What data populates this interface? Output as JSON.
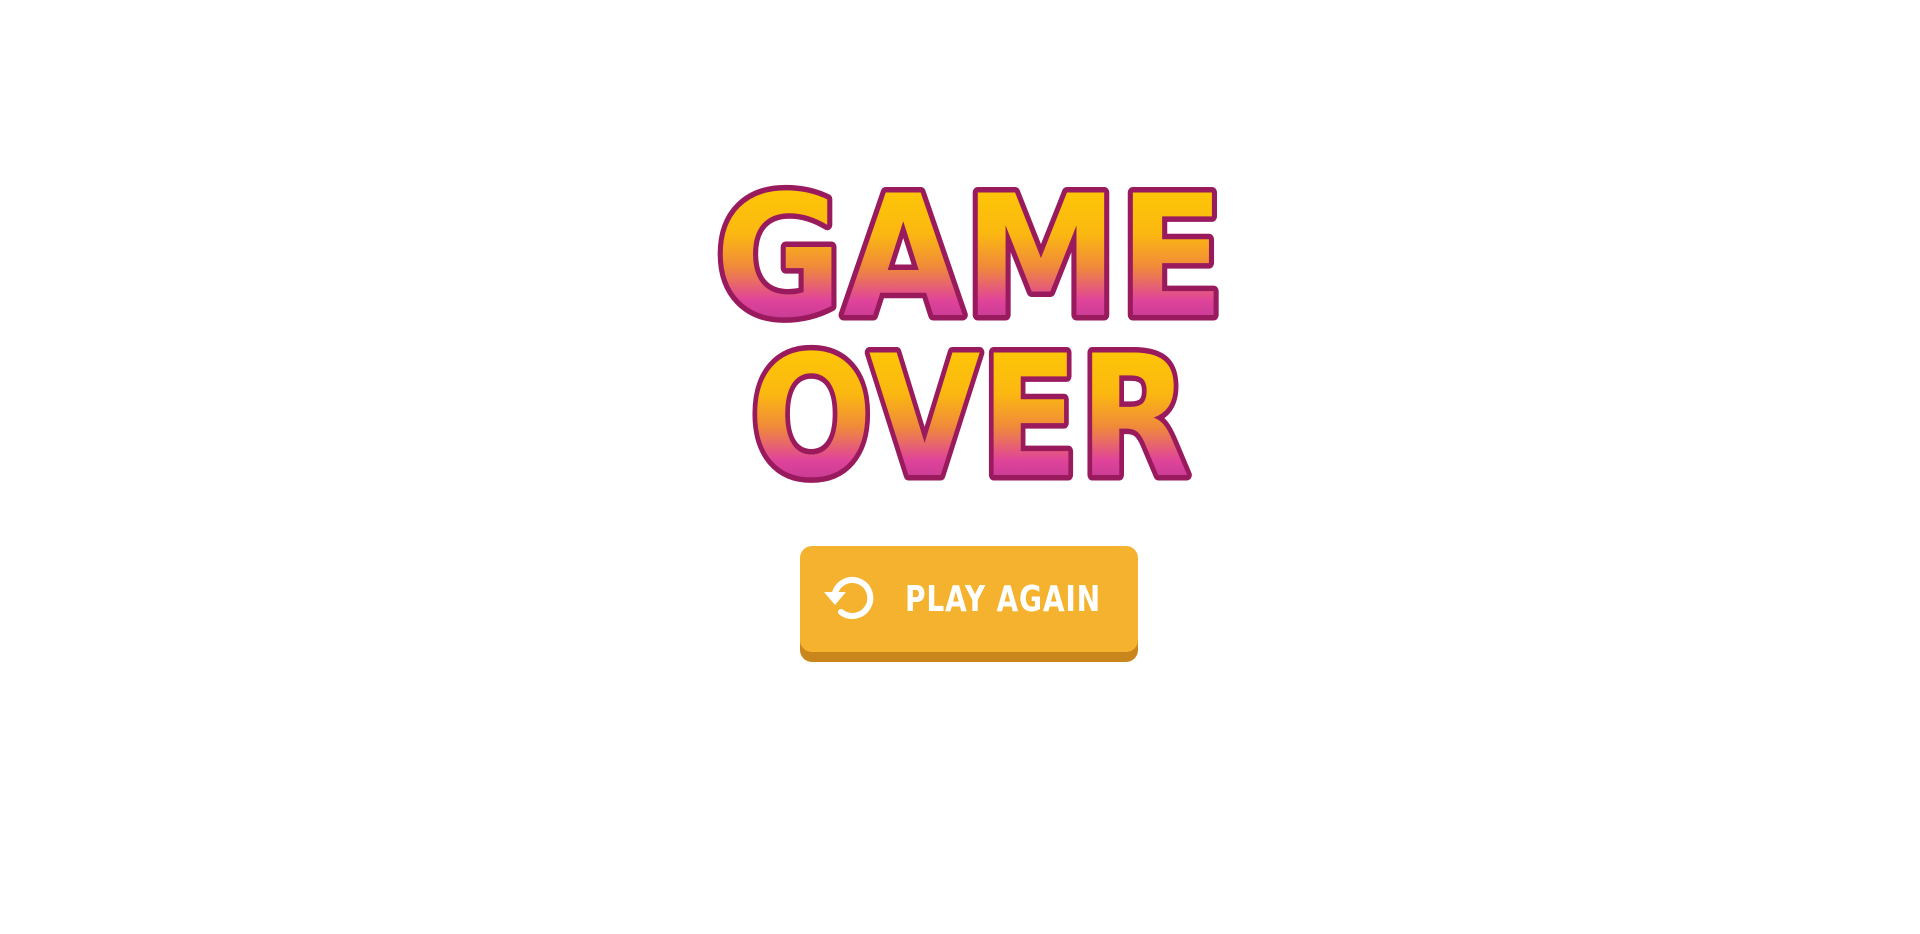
{
  "title": {
    "line1": "GAME",
    "line2": "OVER",
    "colors": {
      "gradient_top": "#ffd000",
      "gradient_mid": "#f08a3a",
      "gradient_low": "#e0449a",
      "gradient_bottom": "#9b2a8c",
      "outline": "#9a1a5e"
    }
  },
  "play_again": {
    "label": "Play Again",
    "icon": "restart-icon",
    "colors": {
      "background": "#f5b22e",
      "shadow": "#c8861d",
      "text": "#ffffff"
    }
  }
}
